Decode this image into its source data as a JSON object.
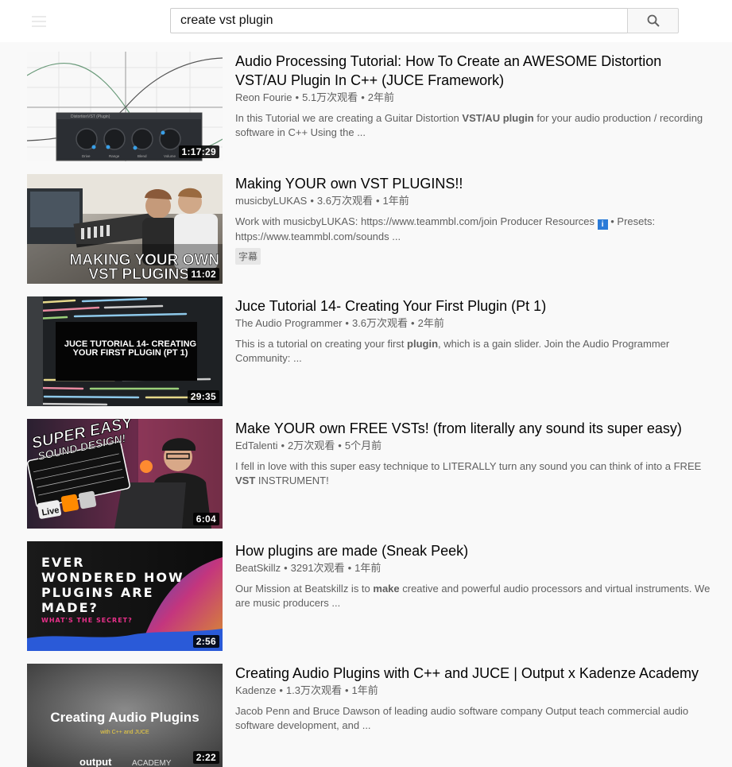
{
  "search": {
    "query": "create vst plugin"
  },
  "icons": {
    "search": "search-icon",
    "menu": "menu-icon"
  },
  "results": [
    {
      "title": "Audio Processing Tutorial: How To Create an AWESOME Distortion VST/AU Plugin In C++ (JUCE Framework)",
      "channel": "Reon Fourie",
      "views": "5.1万次观看",
      "age": "2年前",
      "desc_parts": [
        [
          "In this Tutorial we are creating a Guitar Distortion ",
          false
        ],
        [
          "VST/AU",
          true
        ],
        [
          " ",
          false
        ],
        [
          "plugin",
          true
        ],
        [
          " for your audio production / recording software in C++ Using the ...",
          false
        ]
      ],
      "duration": "1:17:29",
      "thumb_texts": {
        "window_title": "DistortionVST (Plugin)",
        "knobs": [
          "Drive",
          "Range",
          "Blend",
          "Volume"
        ]
      }
    },
    {
      "title": "Making YOUR own VST PLUGINS!!",
      "channel": "musicbyLUKAS",
      "views": "3.6万次观看",
      "age": "1年前",
      "desc_line1": "Work with musicbyLUKAS: https://www.teammbl.com/join Producer Resources",
      "desc_icon": "i",
      "desc_line1b": " • Presets: https://www.teammbl.com/sounds ...",
      "badge": "字幕",
      "duration": "11:02",
      "thumb_texts": {
        "line1": "MAKING YOUR OWN",
        "line2": "VST PLUGINS"
      }
    },
    {
      "title": "Juce Tutorial 14- Creating Your First Plugin (Pt 1)",
      "channel": "The Audio Programmer",
      "views": "3.6万次观看",
      "age": "2年前",
      "desc_parts": [
        [
          "This is a tutorial on creating your first ",
          false
        ],
        [
          "plugin",
          true
        ],
        [
          ", which is a gain slider. Join the Audio Programmer Community: ...",
          false
        ]
      ],
      "duration": "29:35",
      "thumb_texts": {
        "line1": "JUCE TUTORIAL 14- CREATING",
        "line2": "YOUR FIRST PLUGIN (PT 1)"
      }
    },
    {
      "title": "Make YOUR own FREE VSTs! (from literally any sound its super easy)",
      "channel": "EdTalenti",
      "views": "2万次观看",
      "age": "5个月前",
      "desc_parts": [
        [
          "I fell in love with this super easy technique to LITERALLY turn any sound you can think of into a FREE ",
          false
        ],
        [
          "VST",
          true
        ],
        [
          " INSTRUMENT!",
          false
        ]
      ],
      "duration": "6:04",
      "thumb_texts": {
        "line1": "SUPER EASY",
        "line2": "SOUND DESIGN!",
        "live": "Live"
      }
    },
    {
      "title": "How plugins are made (Sneak Peek)",
      "channel": "BeatSkillz",
      "views": "3291次观看",
      "age": "1年前",
      "desc_parts": [
        [
          "Our Mission at Beatskillz is to ",
          false
        ],
        [
          "make",
          true
        ],
        [
          " creative and powerful audio processors and virtual instruments. We are music producers ...",
          false
        ]
      ],
      "duration": "2:56",
      "thumb_texts": {
        "l1": "EVER",
        "l2": "WONDERED HOW",
        "l3": "PLUGINS ARE",
        "l4": "MADE?",
        "l5": "WHAT'S THE SECRET?"
      }
    },
    {
      "title": "Creating Audio Plugins with C++ and JUCE | Output x Kadenze Academy",
      "channel": "Kadenze",
      "views": "1.3万次观看",
      "age": "1年前",
      "desc_parts": [
        [
          "Jacob Penn and Bruce Dawson of leading audio software company Output teach commercial audio software development, and ...",
          false
        ]
      ],
      "duration": "2:22",
      "thumb_texts": {
        "line1": "Creating Audio Plugins",
        "line2": "with C++ and JUCE",
        "brand": "output",
        "academy": "ACADEMY"
      }
    }
  ]
}
